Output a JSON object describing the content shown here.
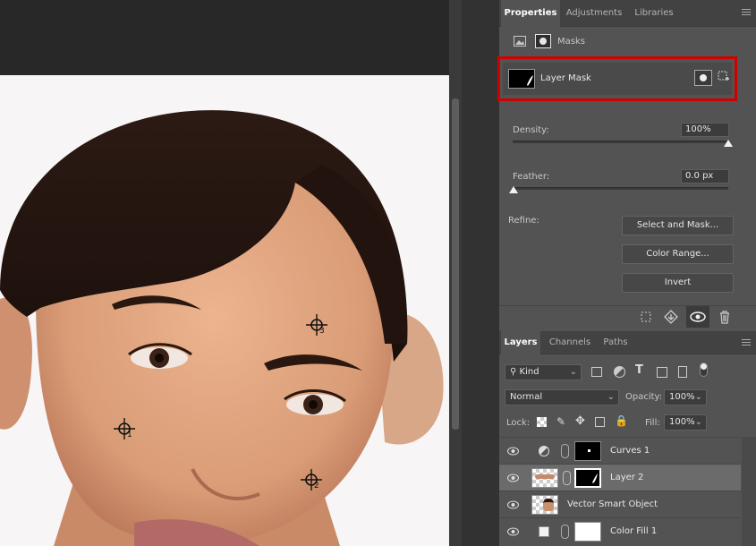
{
  "properties": {
    "tabs": [
      "Properties",
      "Adjustments",
      "Libraries"
    ],
    "section_label": "Masks",
    "layer_mask_label": "Layer Mask",
    "density_label": "Density:",
    "density_value": "100%",
    "density_level": 1.0,
    "feather_label": "Feather:",
    "feather_value": "0.0 px",
    "feather_level": 0.0,
    "refine_label": "Refine:",
    "buttons": [
      "Select and Mask...",
      "Color Range...",
      "Invert"
    ]
  },
  "layers_panel": {
    "tabs": [
      "Layers",
      "Channels",
      "Paths"
    ],
    "filter_kind": "Kind",
    "blend_mode": "Normal",
    "opacity_label": "Opacity:",
    "opacity_value": "100%",
    "lock_label": "Lock:",
    "fill_label": "Fill:",
    "fill_value": "100%",
    "layers": [
      {
        "name": "Curves 1",
        "type": "adjustment"
      },
      {
        "name": "Layer 2",
        "type": "masked",
        "selected": true
      },
      {
        "name": "Vector Smart Object",
        "type": "smart"
      },
      {
        "name": "Color Fill 1",
        "type": "fill"
      }
    ]
  },
  "canvas": {
    "sampler_labels": [
      "1",
      "2",
      "3"
    ]
  },
  "colors": {
    "highlight": "#d00000",
    "panel_bg": "#535353",
    "selected_row": "#6b6b6b"
  }
}
